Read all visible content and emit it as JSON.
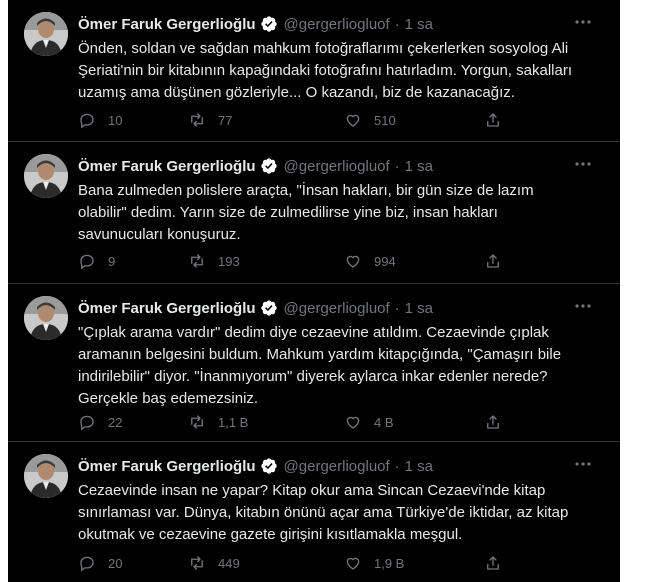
{
  "tweets": [
    {
      "name": "Ömer Faruk Gergerlioğlu",
      "handle": "@gergerliogluof",
      "dot": "·",
      "time": "1 sa",
      "text": "Önden, soldan ve sağdan mahkum fotoğraflarımı çekerlerken sosyolog Ali\nŞeriati'nin bir kitabının kapağındaki fotoğrafını hatırladım. Yorgun, sakalları\nuzamış ama düşünen gözleriyle... O kazandı, biz de kazanacağız.",
      "replies": "10",
      "retweets": "77",
      "likes": "510"
    },
    {
      "name": "Ömer Faruk Gergerlioğlu",
      "handle": "@gergerliogluof",
      "dot": "·",
      "time": "1 sa",
      "text": "Bana zulmeden polislere araçta, \"İnsan hakları, bir gün size de lazım\nolabilir\" dedim. Yarın size de zulmedilirse yine biz, insan hakları\nsavunucuları konuşuruz.",
      "replies": "9",
      "retweets": "193",
      "likes": "994"
    },
    {
      "name": "Ömer Faruk Gergerlioğlu",
      "handle": "@gergerliogluof",
      "dot": "·",
      "time": "1 sa",
      "text": "\"Çıplak arama vardır\" dedim diye cezaevine atıldım. Cezaevinde çıplak\naramanın belgesini buldum. Mahkum yardım kitapçığında, \"Çamaşırı bile\nindirilebilir\" diyor. \"İnanmıyorum\" diyerek aylarca inkar edenler nerede?\nGerçekle baş edemezsiniz.",
      "replies": "22",
      "retweets": "1,1 B",
      "likes": "4 B"
    },
    {
      "name": "Ömer Faruk Gergerlioğlu",
      "handle": "@gergerliogluof",
      "dot": "·",
      "time": "1 sa",
      "text": "Cezaevinde insan ne yapar? Kitap okur ama Sincan Cezaevi'nde kitap\nsınırlaması var. Dünya, kitabın önünü açar ama Türkiye'de iktidar, az kitap\nokutmak ve cezaevine gazete girişini kısıtlamakla meşgul.",
      "replies": "20",
      "retweets": "449",
      "likes": "1,9 B"
    }
  ],
  "icons": {
    "reply": "reply-icon",
    "retweet": "retweet-icon",
    "like": "heart-icon",
    "share": "share-icon",
    "more": "more-icon",
    "verified": "verified-badge-icon",
    "avatar": "avatar"
  },
  "colors": {
    "background": "#000000",
    "text": "#e7e9ea",
    "muted": "#71767b",
    "separator": "#2f3336",
    "verified": "#ffffff"
  }
}
